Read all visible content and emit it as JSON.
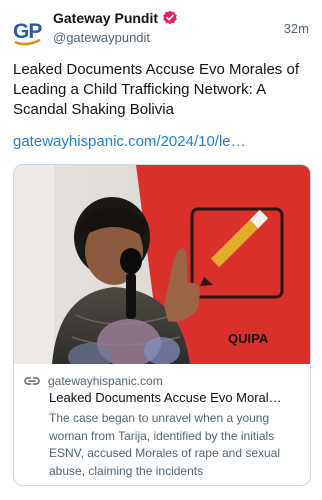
{
  "header": {
    "avatar_text": "GP",
    "account_name": "Gateway Pundit",
    "handle": "@gatewaypundit",
    "time": "32m"
  },
  "post": {
    "text": "Leaked Documents Accuse Evo Morales of Leading a Child Trafficking Network: A Scandal Shaking Bolivia",
    "link": "gatewayhispanic.com/2024/10/le…"
  },
  "card": {
    "domain": "gatewayhispanic.com",
    "title": "Leaked Documents Accuse Evo Moral…",
    "description": "The case began to unravel when a young woman from Tarija, identified by the initials ESNV, accused Morales of rape and sexual abuse, claiming the incidents",
    "banner_text": "QUIPA"
  },
  "icons": {
    "verified": "verified-badge-icon",
    "link": "link-icon"
  },
  "colors": {
    "avatar_blue": "#2a5aa8",
    "avatar_orange": "#e38a1e",
    "verified_red": "#e0245e",
    "link_blue": "#1d7fd8",
    "banner_red": "#d9302b"
  }
}
